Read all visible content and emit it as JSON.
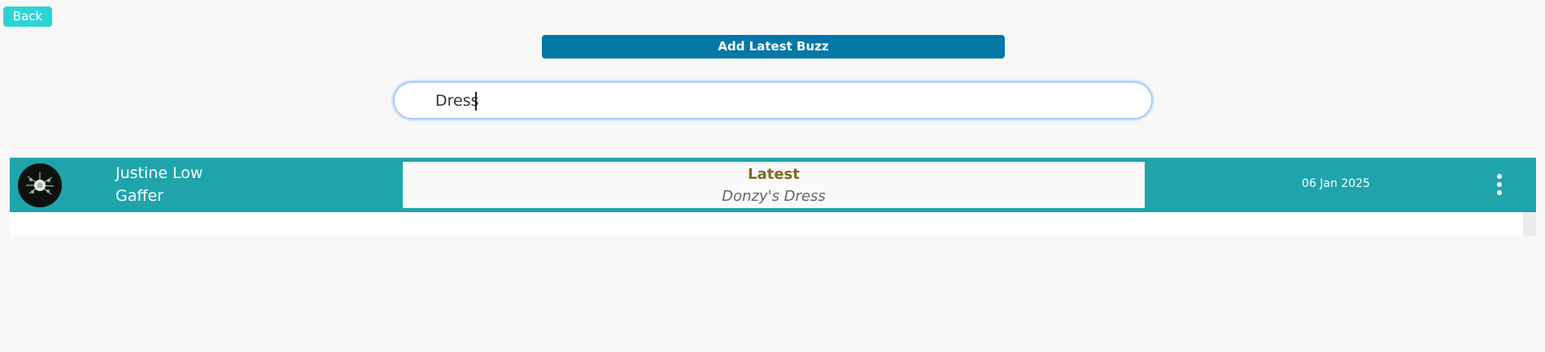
{
  "header": {
    "back_label": "Back",
    "add_label": "Add Latest Buzz"
  },
  "search": {
    "value": "Dress"
  },
  "buzz_list": [
    {
      "name": "Justine Low",
      "role": "Gaffer",
      "category": "Latest",
      "content": "Donzy's Dress",
      "date": "06 Jan 2025",
      "avatar_icon": "avatar-image",
      "menu_icon": "kebab-menu-icon"
    }
  ],
  "colors": {
    "back_button": "#2fd3d3",
    "add_button": "#0578a8",
    "row_background": "#1fa4ac",
    "category_text": "#7e6a22"
  }
}
